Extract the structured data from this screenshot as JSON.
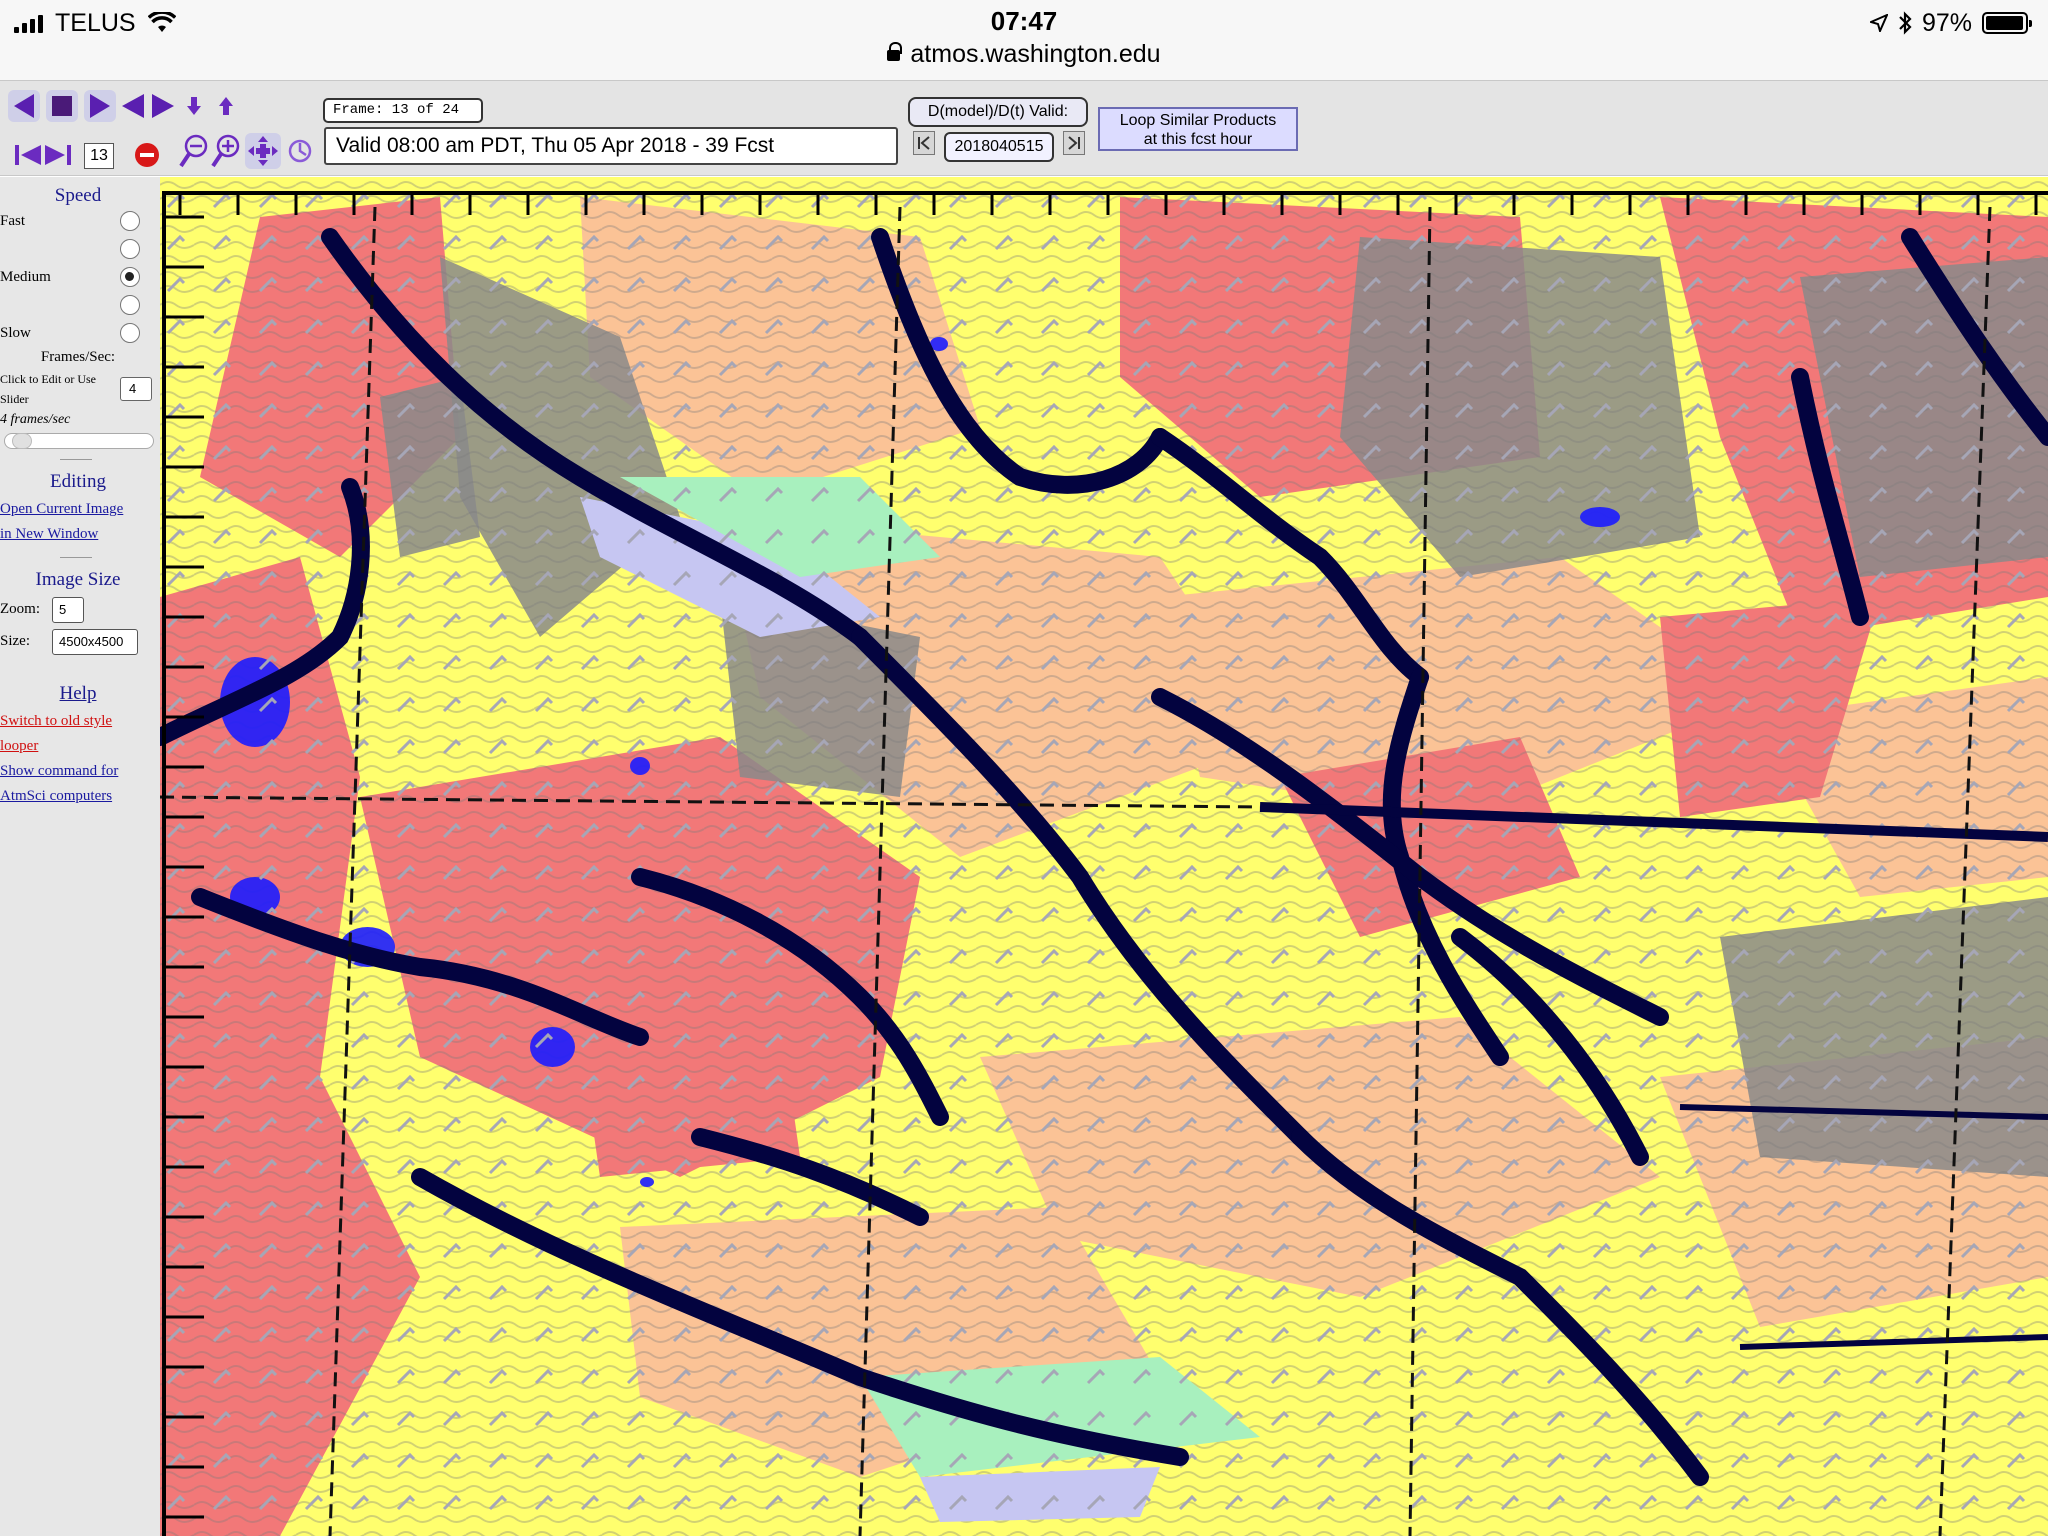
{
  "status_bar": {
    "carrier": "TELUS",
    "time": "07:47",
    "url": "atmos.washington.edu",
    "battery": "97%",
    "battery_level": 0.97
  },
  "toolbar": {
    "frame_number": "13",
    "frame_label": "Frame: 13 of 24",
    "valid_time": "Valid 08:00 am PDT, Thu 05 Apr 2018 - 39 Fcst",
    "dmodel_label": "D(model)/D(t) Valid:",
    "date_value": "2018040515",
    "loop_line1": "Loop Similar Products",
    "loop_line2": "at this fcst hour",
    "icons": [
      "play-reverse-icon",
      "stop-icon",
      "play-forward-icon",
      "rock-icon",
      "step-down-icon",
      "step-up-icon",
      "first-frame-icon",
      "last-frame-icon",
      "no-entry-icon",
      "zoom-out-icon",
      "zoom-in-icon",
      "pan-icon",
      "reset-icon"
    ]
  },
  "sidebar": {
    "speed_title": "Speed",
    "fast_label": "Fast",
    "medium_label": "Medium",
    "slow_label": "Slow",
    "selected_speed_index": 2,
    "frames_sec_label": "Frames/Sec:",
    "click_edit_line1": "Click to Edit or Use",
    "click_edit_line2": "Slider",
    "fps_value": "4",
    "fps_text": "4 frames/sec",
    "slider_fraction": 0.05,
    "editing_title": "Editing",
    "open_image_line1": "Open Current Image",
    "open_image_line2": "in New Window",
    "image_size_title": "Image Size",
    "zoom_label": "Zoom:",
    "zoom_value": "5",
    "size_label": "Size:",
    "size_value": "4500x4500",
    "help_title": "Help",
    "old_style_line1": "Switch to old style",
    "old_style_line2": "looper",
    "show_cmd_line1": "Show command for",
    "show_cmd_line2": "AtmSci computers"
  },
  "map": {
    "colors": {
      "yellow": "#ffff6e",
      "peach": "#fbc396",
      "salmon": "#f27878",
      "gray": "#8a8a8a",
      "blue": "#1c1cff",
      "lavender": "#c6c6f2",
      "mint": "#a8f0be",
      "coast": "#03033f",
      "barb": "#a6a6b6"
    }
  }
}
